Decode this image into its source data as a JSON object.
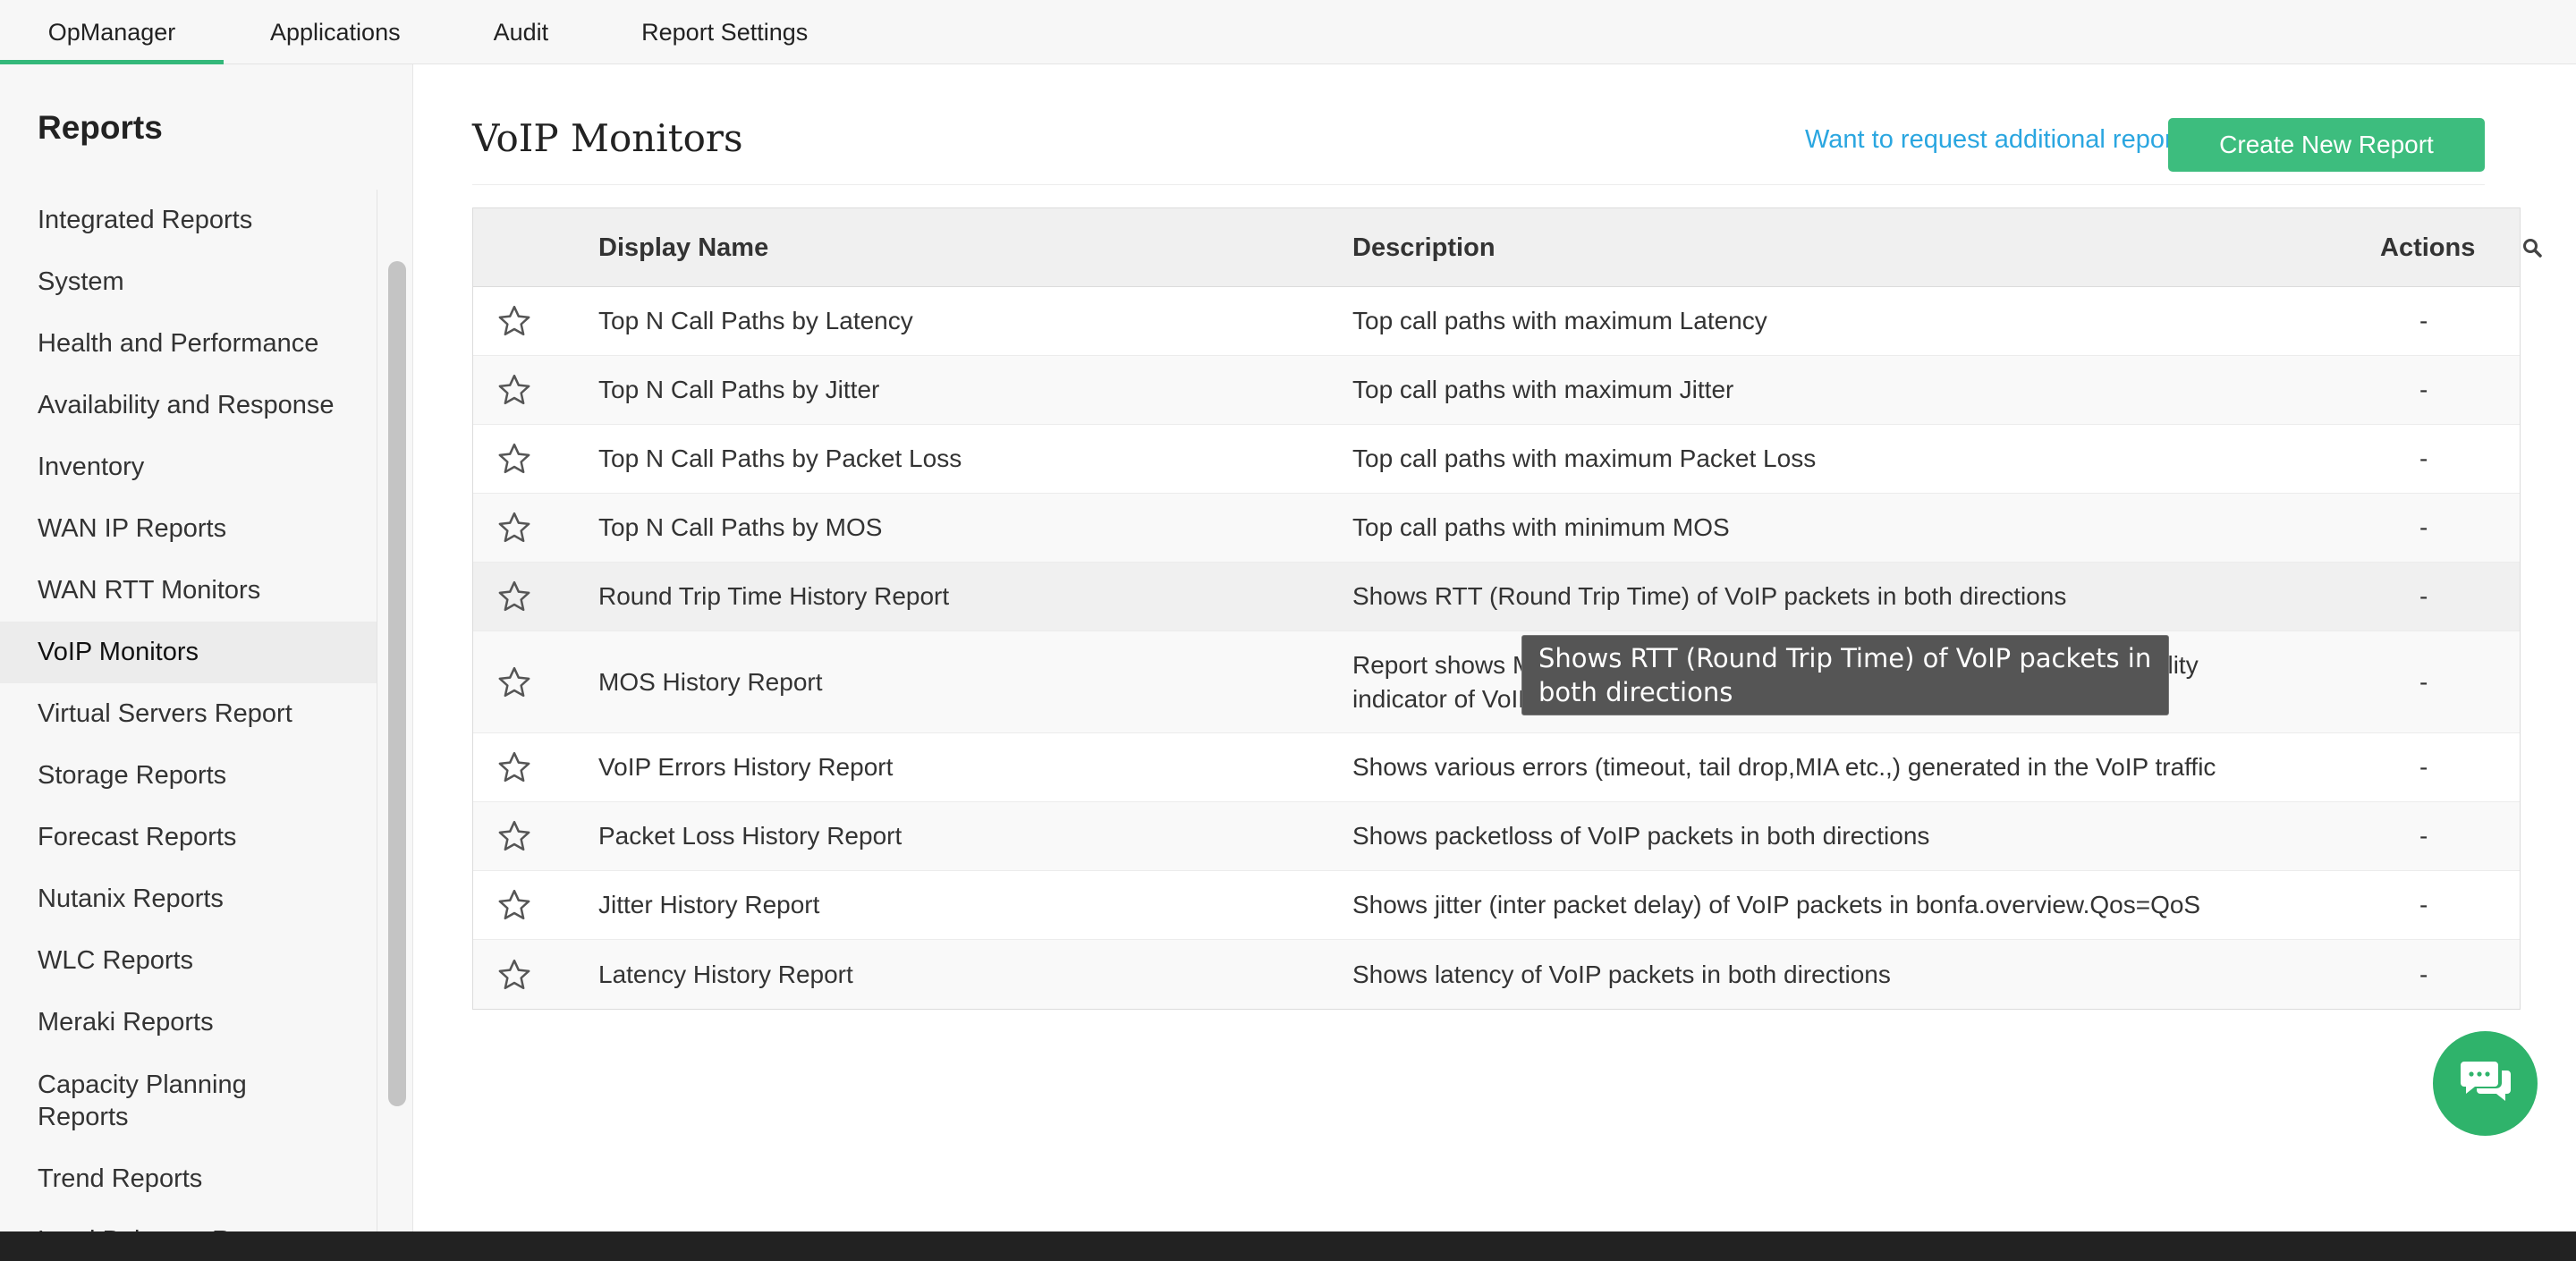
{
  "topnav": {
    "tabs": [
      {
        "label": "OpManager",
        "active": true
      },
      {
        "label": "Applications",
        "active": false
      },
      {
        "label": "Audit",
        "active": false
      },
      {
        "label": "Report Settings",
        "active": false
      }
    ]
  },
  "sidebar": {
    "title": "Reports",
    "items": [
      {
        "label": "Integrated Reports"
      },
      {
        "label": "System"
      },
      {
        "label": "Health and Performance"
      },
      {
        "label": "Availability and Response"
      },
      {
        "label": "Inventory"
      },
      {
        "label": "WAN IP Reports"
      },
      {
        "label": "WAN RTT Monitors"
      },
      {
        "label": "VoIP Monitors",
        "active": true
      },
      {
        "label": "Virtual Servers Report"
      },
      {
        "label": "Storage Reports"
      },
      {
        "label": "Forecast Reports"
      },
      {
        "label": "Nutanix Reports"
      },
      {
        "label": "WLC Reports"
      },
      {
        "label": "Meraki Reports"
      },
      {
        "label": "Capacity Planning Reports"
      },
      {
        "label": "Trend Reports"
      },
      {
        "label": "Load Balancer Reports"
      }
    ]
  },
  "main": {
    "title": "VoIP Monitors",
    "request_link": "Want to request additional reports?",
    "create_button": "Create New Report",
    "table": {
      "columns": {
        "name": "Display Name",
        "description": "Description",
        "actions": "Actions"
      },
      "rows": [
        {
          "name": "Top N Call Paths by Latency",
          "description": "Top call paths with maximum Latency",
          "actions": "-"
        },
        {
          "name": "Top N Call Paths by Jitter",
          "description": "Top call paths with maximum Jitter",
          "actions": "-"
        },
        {
          "name": "Top N Call Paths by Packet Loss",
          "description": "Top call paths with maximum Packet Loss",
          "actions": "-"
        },
        {
          "name": "Top N Call Paths by MOS",
          "description": "Top call paths with minimum MOS",
          "actions": "-"
        },
        {
          "name": "Round Trip Time History Report",
          "description": "Shows RTT (Round Trip Time) of VoIP packets in both directions",
          "actions": "-"
        },
        {
          "name": "MOS History Report",
          "description": "Report shows MOS (Mean Opinion Score) of VoIP packets which is a quality indicator of VoIP calls",
          "actions": "-"
        },
        {
          "name": "VoIP Errors History Report",
          "description": "Shows various errors (timeout, tail drop,MIA etc.,) generated in the VoIP traffic",
          "actions": "-"
        },
        {
          "name": "Packet Loss History Report",
          "description": "Shows packetloss of VoIP packets in both directions",
          "actions": "-"
        },
        {
          "name": "Jitter History Report",
          "description": "Shows jitter (inter packet delay) of VoIP packets in bonfa.overview.Qos=QoS",
          "actions": "-"
        },
        {
          "name": "Latency History Report",
          "description": "Shows latency of VoIP packets in both directions",
          "actions": "-"
        }
      ]
    },
    "tooltip": "Shows RTT (Round Trip Time) of VoIP packets in both directions"
  },
  "icons": {
    "star": "star-outline-icon",
    "search": "search-icon",
    "chat": "chat-icon"
  },
  "colors": {
    "accent_green": "#3dbd7e",
    "link_blue": "#2aa6e0",
    "tooltip_bg": "#555555"
  }
}
